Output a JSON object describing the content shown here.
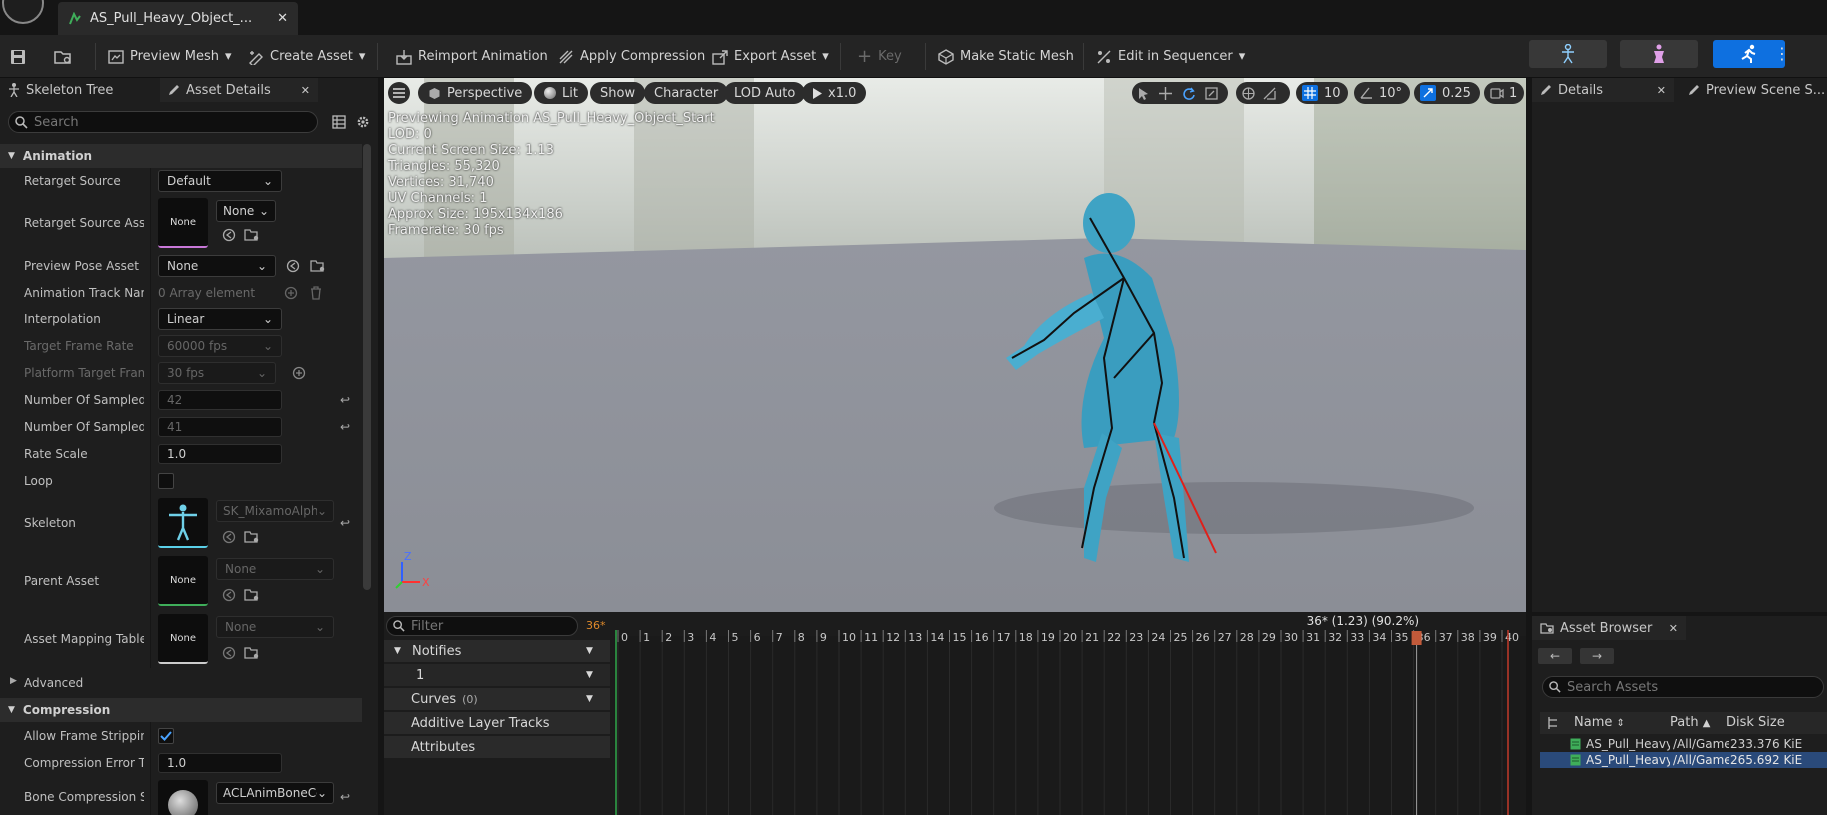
{
  "title_bar": {
    "document_tab": "AS_Pull_Heavy_Object_...",
    "close_symbol": "✕"
  },
  "toolbar": {
    "preview_mesh": "Preview Mesh",
    "create_asset": "Create Asset",
    "reimport_animation": "Reimport Animation",
    "apply_compression": "Apply Compression",
    "export_asset": "Export Asset",
    "key": "Key",
    "make_static_mesh": "Make Static Mesh",
    "edit_in_sequencer": "Edit in Sequencer",
    "accent_color": "#0e70e0"
  },
  "left_panel": {
    "tabs": [
      "Skeleton Tree",
      "Asset Details"
    ],
    "search_placeholder": "Search",
    "categories": {
      "animation": "Animation",
      "advanced": "Advanced",
      "compression": "Compression"
    },
    "properties": {
      "retarget_source": {
        "label": "Retarget Source",
        "value": "Default"
      },
      "retarget_source_asset": {
        "label": "Retarget Source Asset",
        "thumb": "None",
        "value": "None"
      },
      "preview_pose_asset": {
        "label": "Preview Pose Asset",
        "value": "None"
      },
      "animation_track_names": {
        "label": "Animation Track Nam...",
        "value": "0 Array element"
      },
      "interpolation": {
        "label": "Interpolation",
        "value": "Linear"
      },
      "target_frame_rate": {
        "label": "Target Frame Rate",
        "value": "60000 fps"
      },
      "platform_target_frame": {
        "label": "Platform Target Fram...",
        "value": "30 fps"
      },
      "number_sampled_keys": {
        "label": "Number Of Sampled K...",
        "value": "42"
      },
      "number_sampled_frames": {
        "label": "Number Of Sampled F...",
        "value": "41"
      },
      "rate_scale": {
        "label": "Rate Scale",
        "value": "1.0"
      },
      "loop": {
        "label": "Loop",
        "checked": false
      },
      "skeleton": {
        "label": "Skeleton",
        "value": "SK_MixamoAlph"
      },
      "parent_asset": {
        "label": "Parent Asset",
        "thumb": "None",
        "value": "None"
      },
      "asset_mapping_table": {
        "label": "Asset Mapping Table",
        "thumb": "None",
        "value": "None"
      },
      "allow_frame_stripping": {
        "label": "Allow Frame Stripping",
        "checked": true
      },
      "compression_error_threshold": {
        "label": "Compression Error Thr...",
        "value": "1.0"
      },
      "bone_compression_settings": {
        "label": "Bone Compression Se...",
        "value": "ACLAnimBoneCo"
      }
    }
  },
  "viewport": {
    "buttons": {
      "perspective": "Perspective",
      "lit": "Lit",
      "show": "Show",
      "character": "Character",
      "lod": "LOD Auto",
      "speed": "x1.0"
    },
    "grid_snap": "10",
    "rotation_snap": "10°",
    "scale_snap": "0.25",
    "camera_speed": "1",
    "stats": [
      "Previewing Animation AS_Pull_Heavy_Object_Start",
      "LOD: 0",
      "Current Screen Size: 1.13",
      "Triangles: 55,320",
      "Vertices: 31,740",
      "UV Channels: 1",
      "Approx Size: 195x134x186",
      "Framerate: 30 fps"
    ],
    "axis_z": "Z",
    "axis_x": "X"
  },
  "timeline": {
    "filter_placeholder": "Filter",
    "current_frame": "36*",
    "playhead_label": "36* (1.23) (90.2%)",
    "playhead_frame": 36,
    "total_frames": 40,
    "tracks": {
      "notifies": "Notifies",
      "notify_track": "1",
      "curves": "Curves",
      "curves_count": "(0)",
      "additive": "Additive Layer Tracks",
      "attributes": "Attributes"
    },
    "ticks": [
      "0",
      "1",
      "2",
      "3",
      "4",
      "5",
      "6",
      "7",
      "8",
      "9",
      "10",
      "11",
      "12",
      "13",
      "14",
      "15",
      "16",
      "17",
      "18",
      "19",
      "20",
      "21",
      "22",
      "23",
      "24",
      "25",
      "26",
      "27",
      "28",
      "29",
      "30",
      "31",
      "32",
      "33",
      "34",
      "35",
      "36",
      "37",
      "38",
      "39",
      "40"
    ]
  },
  "right_panel": {
    "tabs": [
      "Details",
      "Preview Scene S..."
    ]
  },
  "asset_browser": {
    "tab": "Asset Browser",
    "search_placeholder": "Search Assets",
    "columns": {
      "name": "Name",
      "path": "Path",
      "disk_size": "Disk Size"
    },
    "rows": [
      {
        "name": "AS_Pull_Heavy_C",
        "path": "/All/Game",
        "size": "233.376 KiE"
      },
      {
        "name": "AS_Pull_Heavy_C",
        "path": "/All/Game",
        "size": "265.692 KiE"
      }
    ]
  }
}
